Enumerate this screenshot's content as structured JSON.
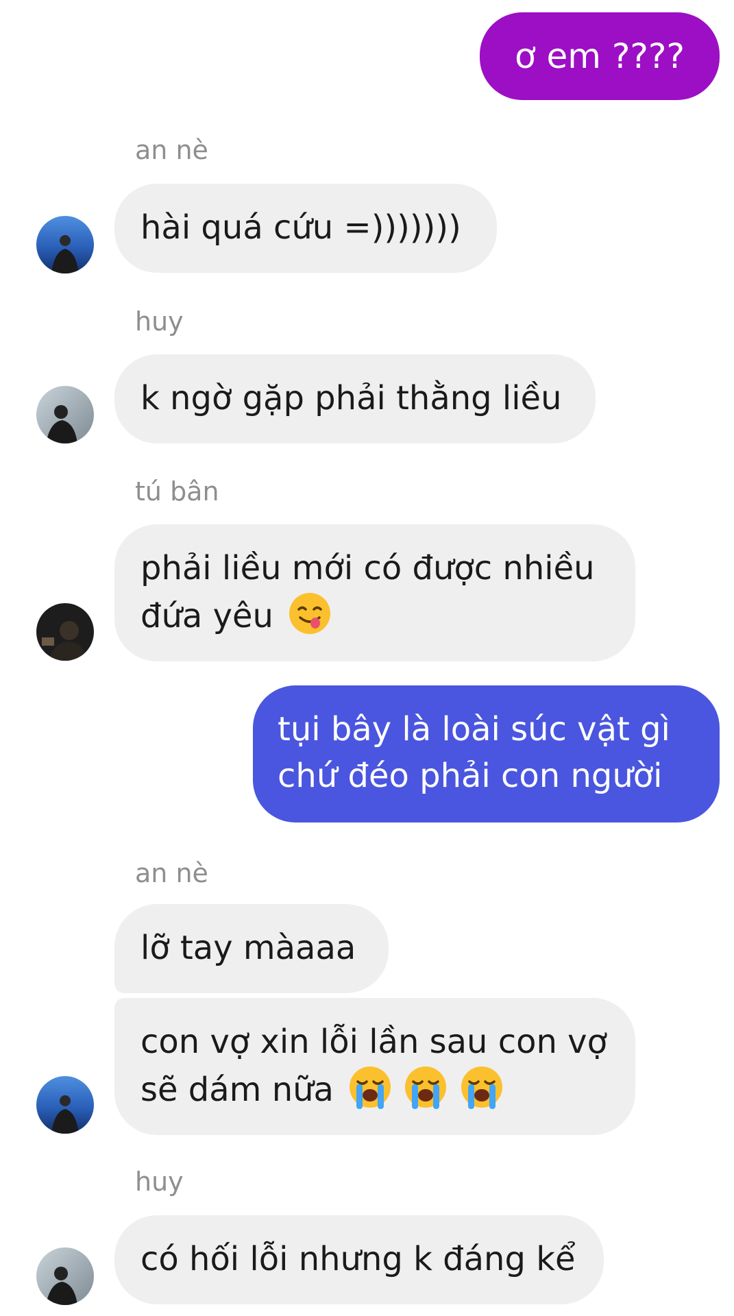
{
  "colors": {
    "outgoing_purple": "#9c0fc4",
    "outgoing_blue": "#4a56df",
    "incoming_bg": "#efefef",
    "sender_name": "#8e8e8e"
  },
  "messages": [
    {
      "direction": "outgoing",
      "text": "ơ em ????"
    },
    {
      "direction": "incoming",
      "sender": "an nè",
      "avatar": "avatar-an-ne",
      "text": "hài quá cứu =)))))))"
    },
    {
      "direction": "incoming",
      "sender": "huy",
      "avatar": "avatar-huy",
      "text": "k ngờ gặp phải thằng liều"
    },
    {
      "direction": "incoming",
      "sender": "tú bân",
      "avatar": "avatar-tu-ban",
      "lines": [
        "phải liều mới có được nhiều",
        "đứa yêu"
      ],
      "emoji": "face-savoring-food-icon"
    },
    {
      "direction": "outgoing",
      "lines": [
        "tụi bây là loài súc vật gì",
        "chứ đéo phải con người"
      ]
    },
    {
      "direction": "incoming",
      "sender": "an nè",
      "avatar": "avatar-an-ne",
      "text": "lỡ tay màaaa"
    },
    {
      "direction": "incoming",
      "avatar": "avatar-an-ne",
      "lines": [
        "con vợ xin lỗi lần sau con vợ",
        "sẽ dám nữa"
      ],
      "emoji": "loudly-crying-face-icon x3"
    },
    {
      "direction": "incoming",
      "sender": "huy",
      "avatar": "avatar-huy",
      "text": "có hối lỗi nhưng k đáng kể"
    }
  ]
}
